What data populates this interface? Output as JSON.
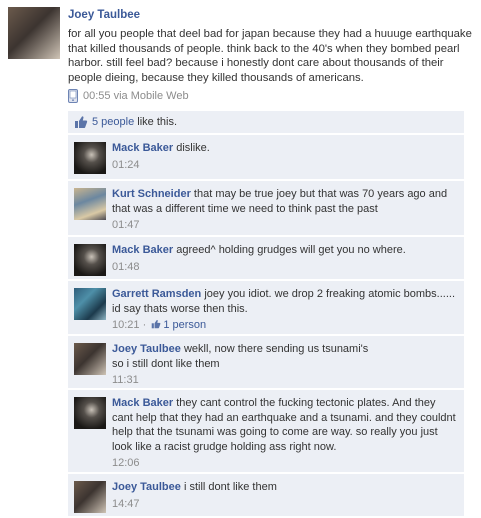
{
  "post": {
    "author": "Joey Taulbee",
    "text": "for all you people that deel bad for japan because they had a huuuge earthquake that killed thousands of people. think back to the 40's when they bombed pearl harbor. still feel bad? because i honestly dont care about thousands of their people dieing, because they killed thousands of americans.",
    "time": "00:55",
    "via": "via Mobile Web"
  },
  "likes": {
    "count_link": "5 people",
    "suffix": " like this."
  },
  "comments": [
    {
      "author": "Mack Baker",
      "text": "dislike.",
      "time": "01:24"
    },
    {
      "author": "Kurt Schneider",
      "text": "that may be true joey but that was 70 years ago and that was a different time we need to think past the past",
      "time": "01:47"
    },
    {
      "author": "Mack Baker",
      "text": "agreed^ holding grudges will get you no where.",
      "time": "01:48"
    },
    {
      "author": "Garrett Ramsden",
      "text": "joey you idiot. we drop 2 freaking atomic bombs...... id say thats worse then this.",
      "time": "10:21",
      "separator": " · ",
      "likes": "1 person"
    },
    {
      "author": "Joey Taulbee",
      "text": "wekll, now there sending us tsunami's so i still dont like them",
      "time": "11:31"
    },
    {
      "author": "Mack Baker",
      "text": "they cant control the fucking tectonic plates. And they cant help that they had an earthquake and a tsunami. and they couldnt help that the tsunami was going to come are way. so really you just look like a racist grudge holding ass right now.",
      "time": "12:06"
    },
    {
      "author": "Joey Taulbee",
      "text": "i still dont like them",
      "time": "14:47"
    }
  ],
  "icons": {
    "mobile": "phone-icon",
    "like": "thumbs-up-icon"
  },
  "colors": {
    "link": "#3b5998",
    "comment_bg": "#eceff5",
    "meta": "#8c8c8c"
  }
}
